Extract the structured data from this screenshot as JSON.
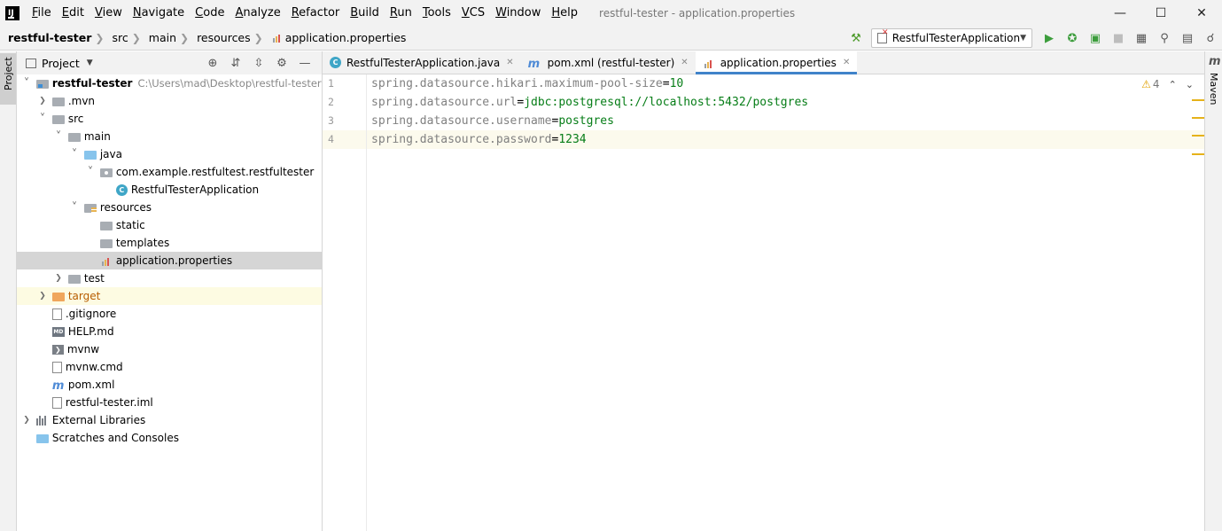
{
  "menu": [
    "File",
    "Edit",
    "View",
    "Navigate",
    "Code",
    "Analyze",
    "Refactor",
    "Build",
    "Run",
    "Tools",
    "VCS",
    "Window",
    "Help"
  ],
  "window_title": "restful-tester - application.properties",
  "breadcrumbs": [
    "restful-tester",
    "src",
    "main",
    "resources",
    "application.properties"
  ],
  "run_config": "RestfulTesterApplication",
  "left_stripe_tab": "Project",
  "right_stripe_tab": "Maven",
  "panel": {
    "title": "Project"
  },
  "tree": [
    {
      "label": "restful-tester",
      "path": "C:\\Users\\mad\\Desktop\\restful-tester",
      "depth": 0,
      "arrow": "open",
      "icon": "module-folder",
      "bold": true
    },
    {
      "label": ".mvn",
      "depth": 1,
      "arrow": "closed",
      "icon": "folder"
    },
    {
      "label": "src",
      "depth": 1,
      "arrow": "open",
      "icon": "folder"
    },
    {
      "label": "main",
      "depth": 2,
      "arrow": "open",
      "icon": "folder"
    },
    {
      "label": "java",
      "depth": 3,
      "arrow": "open",
      "icon": "blue-folder"
    },
    {
      "label": "com.example.restfultest.restfultester",
      "depth": 4,
      "arrow": "open",
      "icon": "package"
    },
    {
      "label": "RestfulTesterApplication",
      "depth": 5,
      "arrow": "none",
      "icon": "class"
    },
    {
      "label": "resources",
      "depth": 3,
      "arrow": "open",
      "icon": "resources-folder"
    },
    {
      "label": "static",
      "depth": 4,
      "arrow": "none",
      "icon": "folder"
    },
    {
      "label": "templates",
      "depth": 4,
      "arrow": "none",
      "icon": "folder"
    },
    {
      "label": "application.properties",
      "depth": 4,
      "arrow": "none",
      "icon": "properties",
      "selected": true
    },
    {
      "label": "test",
      "depth": 2,
      "arrow": "closed",
      "icon": "folder"
    },
    {
      "label": "target",
      "depth": 1,
      "arrow": "closed",
      "icon": "orange-folder",
      "excluded": true
    },
    {
      "label": ".gitignore",
      "depth": 1,
      "arrow": "none",
      "icon": "gitignore"
    },
    {
      "label": "HELP.md",
      "depth": 1,
      "arrow": "none",
      "icon": "markdown"
    },
    {
      "label": "mvnw",
      "depth": 1,
      "arrow": "none",
      "icon": "terminal"
    },
    {
      "label": "mvnw.cmd",
      "depth": 1,
      "arrow": "none",
      "icon": "file"
    },
    {
      "label": "pom.xml",
      "depth": 1,
      "arrow": "none",
      "icon": "maven"
    },
    {
      "label": "restful-tester.iml",
      "depth": 1,
      "arrow": "none",
      "icon": "file"
    },
    {
      "label": "External Libraries",
      "depth": 0,
      "arrow": "closed",
      "icon": "libraries"
    },
    {
      "label": "Scratches and Consoles",
      "depth": 0,
      "arrow": "none",
      "icon": "scratches"
    }
  ],
  "tabs": [
    {
      "label": "RestfulTesterApplication.java",
      "icon": "class",
      "active": false
    },
    {
      "label": "pom.xml (restful-tester)",
      "icon": "maven",
      "active": false
    },
    {
      "label": "application.properties",
      "icon": "properties",
      "active": true
    }
  ],
  "code_lines": [
    {
      "num": "1",
      "key": "spring.datasource.hikari.maximum-pool-size",
      "value": "10"
    },
    {
      "num": "2",
      "key": "spring.datasource.url",
      "value": "jdbc:postgresql://localhost:5432/postgres"
    },
    {
      "num": "3",
      "key": "spring.datasource.username",
      "value": "postgres"
    },
    {
      "num": "4",
      "key": "spring.datasource.password",
      "value": "1234",
      "caret": true
    }
  ],
  "inspections": {
    "warnings": "4"
  },
  "colors": {
    "accent": "#4083c9",
    "selection": "#d5d5d5",
    "string": "#067d17",
    "key": "#808080",
    "warning": "#e6b21a"
  }
}
